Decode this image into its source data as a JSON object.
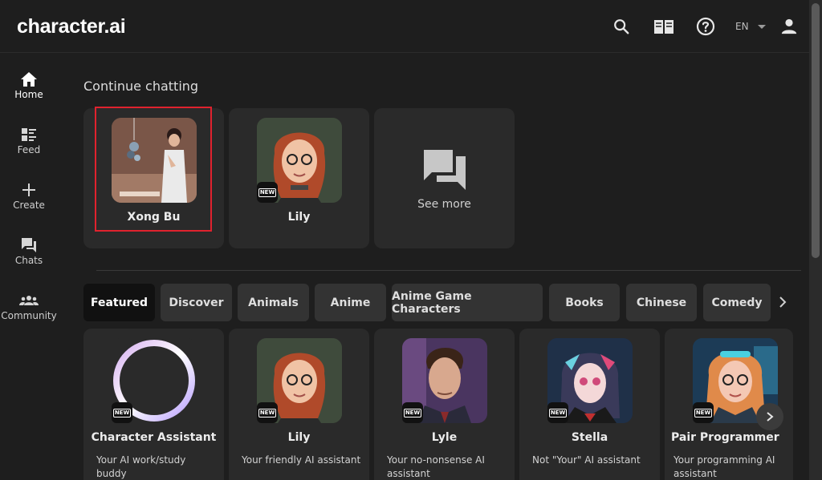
{
  "app": {
    "logo": "character.ai"
  },
  "header": {
    "language": "EN"
  },
  "sidebar": {
    "items": [
      {
        "label": "Home",
        "icon": "home-icon"
      },
      {
        "label": "Feed",
        "icon": "feed-icon"
      },
      {
        "label": "Create",
        "icon": "plus-icon"
      },
      {
        "label": "Chats",
        "icon": "chats-icon"
      },
      {
        "label": "Community",
        "icon": "community-icon"
      }
    ]
  },
  "continue": {
    "title": "Continue chatting",
    "items": [
      {
        "name": "Xong Bu"
      },
      {
        "name": "Lily"
      }
    ],
    "see_more": "See more"
  },
  "categories": [
    "Featured",
    "Discover",
    "Animals",
    "Anime",
    "Anime Game Characters",
    "Books",
    "Chinese",
    "Comedy"
  ],
  "featured": [
    {
      "name": "Character Assistant",
      "desc": "Your AI work/study buddy"
    },
    {
      "name": "Lily",
      "desc": "Your friendly AI assistant"
    },
    {
      "name": "Lyle",
      "desc": "Your no-nonsense AI assistant"
    },
    {
      "name": "Stella",
      "desc": "Not \"Your\" AI assistant"
    },
    {
      "name": "Pair Programmer",
      "desc": "Your programming AI assistant"
    }
  ],
  "badge": "NEW",
  "colors": {
    "background": "#1e1e1e",
    "card": "#2a2a2a",
    "chip": "#333333",
    "chip_active": "#111111",
    "highlight": "#e0222e"
  }
}
